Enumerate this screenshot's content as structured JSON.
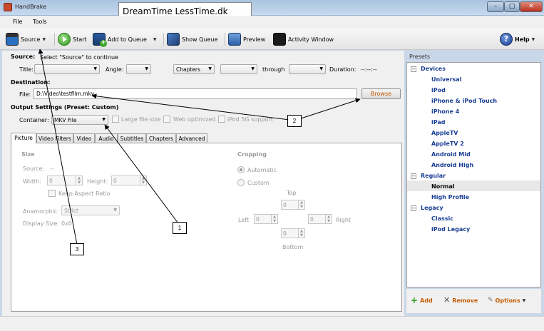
{
  "window": {
    "title": "HandBrake",
    "watermark": "DreamTime LessTime.dk",
    "min": "–",
    "max": "□",
    "close": "✕"
  },
  "menu": [
    "File",
    "Tools"
  ],
  "toolbar": {
    "source": "Source",
    "start": "Start",
    "add_to_queue": "Add to Queue",
    "show_queue": "Show Queue",
    "preview": "Preview",
    "activity_window": "Activity Window",
    "help": "Help"
  },
  "source": {
    "heading": "Source:",
    "hint": "Select \"Source\" to continue",
    "title_label": "Title:",
    "angle_label": "Angle:",
    "chapters_value": "Chapters",
    "through_label": "through",
    "duration_label": "Duration:",
    "duration_value": "--:--:--"
  },
  "destination": {
    "heading": "Destination:",
    "file_label": "File:",
    "file_value": "D:\\Video\\testfilm.mkv",
    "browse": "Browse"
  },
  "output": {
    "heading": "Output Settings (Preset: Custom)",
    "container_label": "Container:",
    "container_value": "MKV File",
    "large_file": "Large file size",
    "web_optimized": "Web optimized",
    "ipod_support": "iPod 5G support"
  },
  "tabs": [
    "Picture",
    "Video Filters",
    "Video",
    "Audio",
    "Subtitles",
    "Chapters",
    "Advanced"
  ],
  "picture": {
    "size_heading": "Size",
    "source_label": "Source:",
    "source_value": "--",
    "width_label": "Width:",
    "width_value": "0",
    "height_label": "Height:",
    "height_value": "0",
    "keep_aspect": "Keep Aspect Ratio",
    "anamorphic_label": "Anamorphic:",
    "anamorphic_value": "Strict",
    "display_size_label": "Display Size:",
    "display_size_value": "0x0",
    "cropping_heading": "Cropping",
    "automatic": "Automatic",
    "custom": "Custom",
    "top": "Top",
    "left": "Left",
    "right": "Right",
    "bottom": "Bottom",
    "crop_value": "0"
  },
  "presets": {
    "label": "Presets",
    "groups": [
      {
        "name": "Devices",
        "items": [
          "Universal",
          "iPod",
          "iPhone & iPod Touch",
          "iPhone 4",
          "iPad",
          "AppleTV",
          "AppleTV 2",
          "Android Mid",
          "Android High"
        ]
      },
      {
        "name": "Regular",
        "items": [
          "Normal",
          "High Profile"
        ]
      },
      {
        "name": "Legacy",
        "items": [
          "Classic",
          "iPod Legacy"
        ]
      }
    ],
    "add": "Add",
    "remove": "Remove",
    "options": "Options"
  },
  "callouts": [
    "1",
    "2",
    "3"
  ],
  "colors": {
    "preset_text": "#1b3f94",
    "browse_text": "#c55a00",
    "titlebar": "#b9d0e9"
  }
}
